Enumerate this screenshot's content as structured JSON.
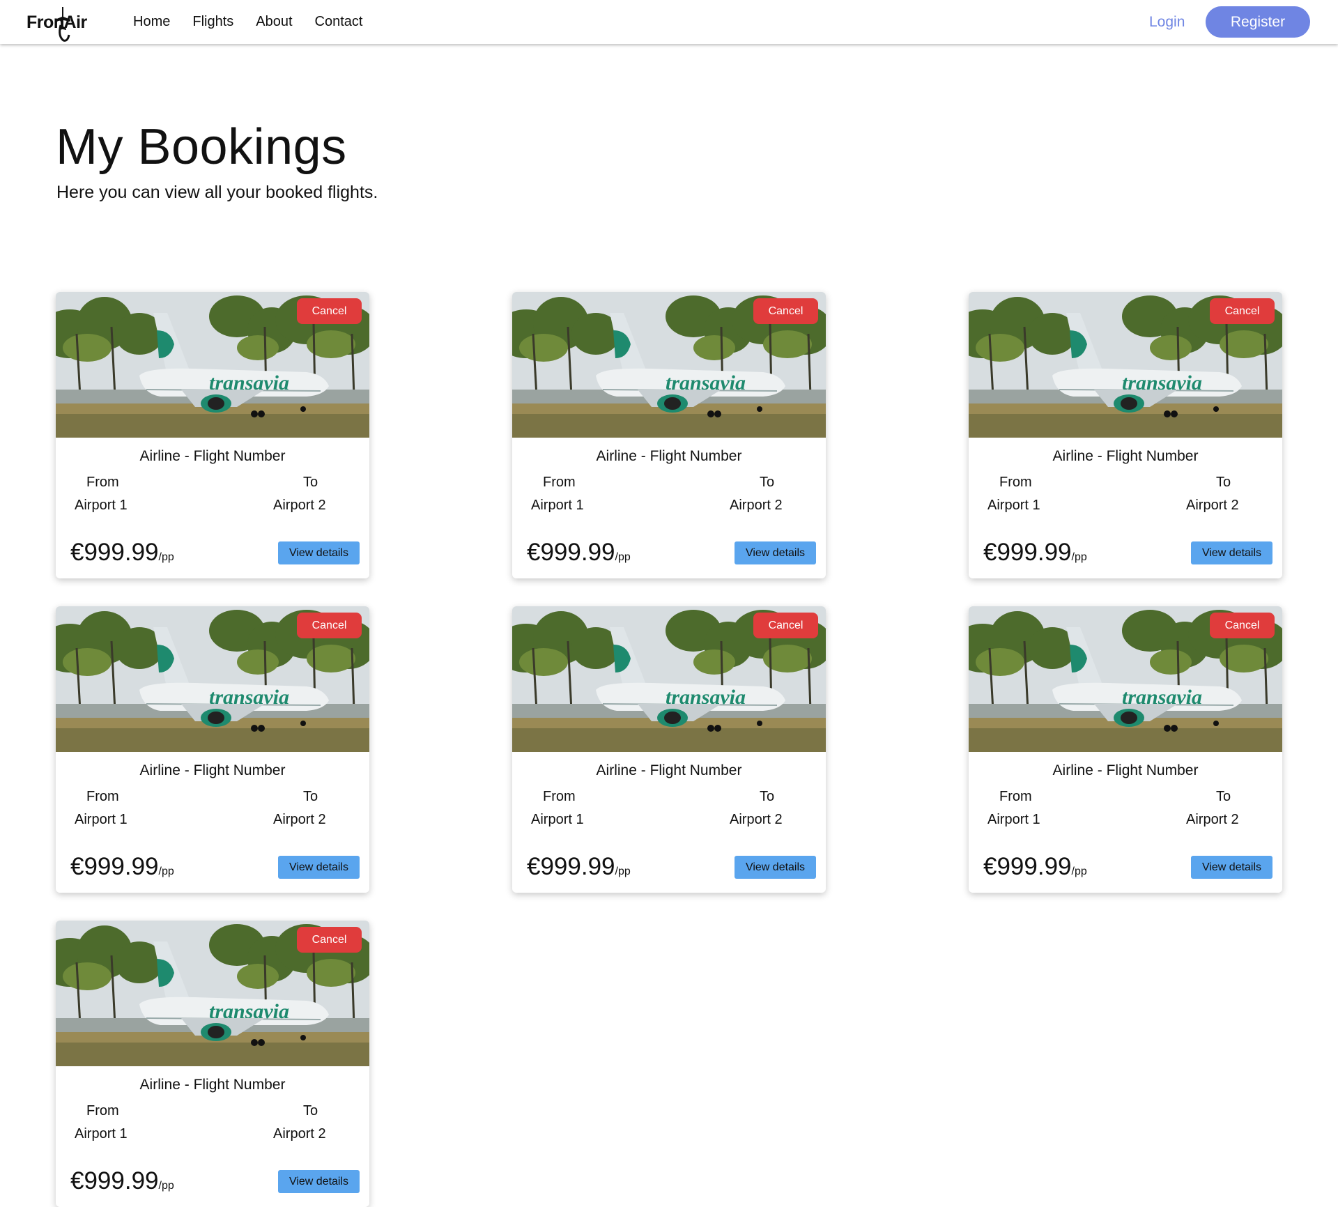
{
  "nav": {
    "brand": "FronAir",
    "links": [
      "Home",
      "Flights",
      "About",
      "Contact"
    ],
    "login_label": "Login",
    "register_label": "Register",
    "accent_color": "#6f85e3"
  },
  "header": {
    "title": "My Bookings",
    "subtitle": "Here you can view all your booked flights."
  },
  "bookings": [
    {
      "cancel_label": "Cancel",
      "flight": "Airline - Flight Number",
      "from_label": "From",
      "to_label": "To",
      "from_airport": "Airport 1",
      "to_airport": "Airport 2",
      "price": "€999.99",
      "price_unit": "/pp",
      "details_label": "View details"
    },
    {
      "cancel_label": "Cancel",
      "flight": "Airline - Flight Number",
      "from_label": "From",
      "to_label": "To",
      "from_airport": "Airport 1",
      "to_airport": "Airport 2",
      "price": "€999.99",
      "price_unit": "/pp",
      "details_label": "View details"
    },
    {
      "cancel_label": "Cancel",
      "flight": "Airline - Flight Number",
      "from_label": "From",
      "to_label": "To",
      "from_airport": "Airport 1",
      "to_airport": "Airport 2",
      "price": "€999.99",
      "price_unit": "/pp",
      "details_label": "View details"
    },
    {
      "cancel_label": "Cancel",
      "flight": "Airline - Flight Number",
      "from_label": "From",
      "to_label": "To",
      "from_airport": "Airport 1",
      "to_airport": "Airport 2",
      "price": "€999.99",
      "price_unit": "/pp",
      "details_label": "View details"
    },
    {
      "cancel_label": "Cancel",
      "flight": "Airline - Flight Number",
      "from_label": "From",
      "to_label": "To",
      "from_airport": "Airport 1",
      "to_airport": "Airport 2",
      "price": "€999.99",
      "price_unit": "/pp",
      "details_label": "View details"
    },
    {
      "cancel_label": "Cancel",
      "flight": "Airline - Flight Number",
      "from_label": "From",
      "to_label": "To",
      "from_airport": "Airport 1",
      "to_airport": "Airport 2",
      "price": "€999.99",
      "price_unit": "/pp",
      "details_label": "View details"
    },
    {
      "cancel_label": "Cancel",
      "flight": "Airline - Flight Number",
      "from_label": "From",
      "to_label": "To",
      "from_airport": "Airport 1",
      "to_airport": "Airport 2",
      "price": "€999.99",
      "price_unit": "/pp",
      "details_label": "View details"
    }
  ],
  "card_image": {
    "subject": "airplane-photo",
    "livery_text": "transavia",
    "livery_color": "#1e8a6e"
  },
  "colors": {
    "cancel": "#e03c3c",
    "view_details": "#5aa5ee"
  }
}
